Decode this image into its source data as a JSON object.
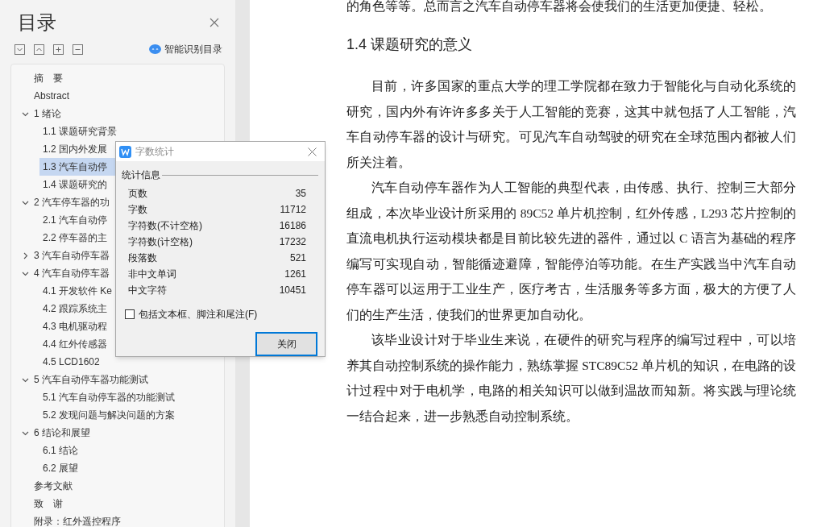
{
  "sidebar": {
    "title": "目录",
    "toolbar": {
      "smart_button": "智能识别目录"
    },
    "outline": [
      {
        "label": "摘　要",
        "selected": false
      },
      {
        "label": "Abstract",
        "selected": false
      },
      {
        "label": "1 绪论",
        "selected": false,
        "expanded": true,
        "children": [
          {
            "label": "1.1 课题研究背景",
            "selected": false
          },
          {
            "label": "1.2 国内外发展",
            "selected": false
          },
          {
            "label": "1.3 汽车自动停",
            "selected": true
          },
          {
            "label": "1.4 课题研究的",
            "selected": false
          }
        ]
      },
      {
        "label": "2 汽车停车器的功",
        "selected": false,
        "expanded": true,
        "children": [
          {
            "label": "2.1 汽车自动停",
            "selected": false
          },
          {
            "label": "2.2 停车器的主",
            "selected": false
          }
        ]
      },
      {
        "label": "3 汽车自动停车器",
        "selected": false,
        "expanded": false
      },
      {
        "label": "4 汽车自动停车器",
        "selected": false,
        "expanded": true,
        "children": [
          {
            "label": "4.1 开发软件 Ke",
            "selected": false
          },
          {
            "label": "4.2 跟踪系统主",
            "selected": false
          },
          {
            "label": "4.3 电机驱动程",
            "selected": false
          },
          {
            "label": "4.4 红外传感器",
            "selected": false
          },
          {
            "label": "4.5 LCD1602",
            "selected": false
          }
        ]
      },
      {
        "label": "5 汽车自动停车器功能测试",
        "selected": false,
        "expanded": true,
        "children": [
          {
            "label": "5.1 汽车自动停车器的功能测试",
            "selected": false
          },
          {
            "label": "5.2 发现问题与解决问题的方案",
            "selected": false
          }
        ]
      },
      {
        "label": "6 结论和展望",
        "selected": false,
        "expanded": true,
        "children": [
          {
            "label": "6.1 结论",
            "selected": false
          },
          {
            "label": "6.2 展望",
            "selected": false
          }
        ]
      },
      {
        "label": "参考文献",
        "selected": false
      },
      {
        "label": "致　谢",
        "selected": false
      },
      {
        "label": "附录：红外遥控程序",
        "selected": false
      }
    ]
  },
  "document": {
    "top_line": "的角色等等。总而言之汽车自动停车器将会使我们的生活更加便捷、轻松。",
    "heading": "1.4 课题研究的意义",
    "paragraphs": [
      "目前，许多国家的重点大学的理工学院都在致力于智能化与自动化系统的研究，国内外有许许多多关于人工智能的竞赛，这其中就包括了人工智能，汽车自动停车器的设计与研究。可见汽车自动驾驶的研究在全球范围内都被人们所关注着。",
      "汽车自动停车器作为人工智能的典型代表，由传感、执行、控制三大部分组成，本次毕业设计所采用的 89C52 单片机控制，红外传感，L293 芯片控制的直流电机执行运动模块都是目前比较先进的器件，通过以 C 语言为基础的程序编写可实现自动，智能循迹避障，智能停泊等功能。在生产实践当中汽车自动停车器可以运用于工业生产，医疗考古，生活服务等多方面，极大的方便了人们的生产生活，使我们的世界更加自动化。",
      "该毕业设计对于毕业生来说，在硬件的研究与程序的编写过程中，可以培养其自动控制系统的操作能力，熟练掌握 STC89C52 单片机的知识，在电路的设计过程中对于电机学，电路的相关知识可以做到温故而知新。将实践与理论统一结合起来，进一步熟悉自动控制系统。"
    ]
  },
  "dialog": {
    "title": "字数统计",
    "group": "统计信息",
    "stats": [
      {
        "label": "页数",
        "value": "35"
      },
      {
        "label": "字数",
        "value": "11712"
      },
      {
        "label": "字符数(不计空格)",
        "value": "16186"
      },
      {
        "label": "字符数(计空格)",
        "value": "17232"
      },
      {
        "label": "段落数",
        "value": "521"
      },
      {
        "label": "非中文单词",
        "value": "1261"
      },
      {
        "label": "中文字符",
        "value": "10451"
      }
    ],
    "checkbox": {
      "label": "包括文本框、脚注和尾注(F)",
      "checked": false
    },
    "close_button": "关闭"
  }
}
